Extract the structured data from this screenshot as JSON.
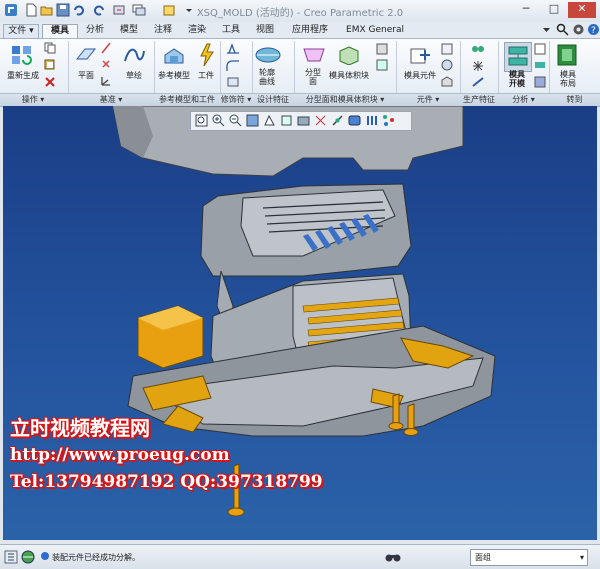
{
  "window": {
    "title": "XSQ_MOLD (活动的) - Creo Parametric 2.0",
    "minimize_icon": "minimize-icon",
    "maximize_icon": "maximize-icon",
    "close_icon": "close-icon"
  },
  "quick_access": [
    "new-icon",
    "open-icon",
    "save-icon",
    "undo-icon",
    "redo-icon",
    "regenerate-icon",
    "windows-icon",
    "close-window-icon",
    "customize-icon"
  ],
  "tabs": [
    {
      "label": "文件 ▾"
    },
    {
      "label": "模具"
    },
    {
      "label": "分析"
    },
    {
      "label": "模型"
    },
    {
      "label": "注释"
    },
    {
      "label": "渲染"
    },
    {
      "label": "工具"
    },
    {
      "label": "视图"
    },
    {
      "label": "应用程序"
    },
    {
      "label": "EMX General"
    }
  ],
  "active_tab": "模具",
  "ribbon_buttons": {
    "regenerate": "重新生成",
    "plane": "平面",
    "sketch": "草绘",
    "reference_model": "参考模型",
    "workpiece": "工件",
    "parting_surface_line1": "轮廓",
    "parting_surface_line2": "曲线",
    "parting_line1": "分型",
    "parting_line2": "面",
    "mold_volume": "模具体积块",
    "mold_component": "模具元件",
    "mold_open_line1": "模具",
    "mold_open_line2": "开模",
    "mold_layout_line1": "模具",
    "mold_layout_line2": "布局"
  },
  "ribbon_groups": [
    {
      "label": "操作 ▾"
    },
    {
      "label": "基准 ▾"
    },
    {
      "label": "参考模型和工件"
    },
    {
      "label": "修饰符 ▾"
    },
    {
      "label": "设计特征"
    },
    {
      "label": "分型面和模具体积块 ▾"
    },
    {
      "label": "元件 ▾"
    },
    {
      "label": "生产特征 ▾"
    },
    {
      "label": "分析 ▾"
    },
    {
      "label": "转到"
    }
  ],
  "view_toolbar": [
    "refit-icon",
    "zoom-in-icon",
    "zoom-out-icon",
    "repaint-icon",
    "reorient-icon",
    "saved-views-icon",
    "display-style-icon",
    "datum-display-icon",
    "spin-center-icon",
    "annotation-icon",
    "layers-icon",
    "explode-icon"
  ],
  "watermark": {
    "line1": "立时视频教程网",
    "line2": "http://www.proeug.com",
    "line3": "Tel:13794987192  QQ:397318799"
  },
  "status": {
    "message": "装配元件已经成功分解。",
    "filter_value": "面组"
  },
  "colors": {
    "viewport_top": "#1a3e86",
    "mold_gray": "#9aa0a8",
    "pin_orange": "#e8a010",
    "watermark_outline": "#d11111"
  }
}
